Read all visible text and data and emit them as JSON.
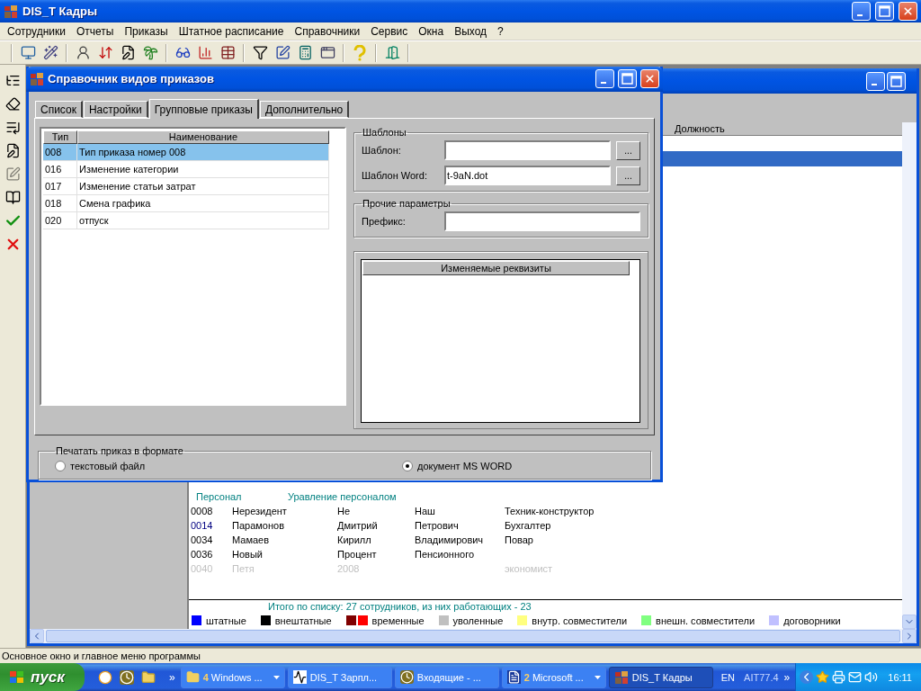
{
  "window": {
    "title": "DIS_T Кадры"
  },
  "menu": [
    "Сотрудники",
    "Отчеты",
    "Приказы",
    "Штатное расписание",
    "Справочники",
    "Сервис",
    "Окна",
    "Выход",
    "?"
  ],
  "employee_list": {
    "columns": [
      "Должность"
    ],
    "top_rows": [
      {
        "selected": true
      }
    ],
    "group": {
      "label": "Персонал",
      "department": "Уравление персоналом"
    },
    "rows": [
      {
        "code": "0008",
        "last": "Нерезидент",
        "first": "Не",
        "middle": "Наш",
        "position": "Техник-конструктор",
        "dismissed": false
      },
      {
        "code": "0014",
        "last": "Парамонов",
        "first": "Дмитрий",
        "middle": "Петрович",
        "position": "Бухгалтер",
        "color": "#000080",
        "dismissed": false
      },
      {
        "code": "0034",
        "last": "Мамаев",
        "first": "Кирилл",
        "middle": "Владимирович",
        "position": "Повар",
        "dismissed": false
      },
      {
        "code": "0036",
        "last": "Новый",
        "first": "Процент",
        "middle": "Пенсионного",
        "dismissed": false
      },
      {
        "code": "0040",
        "last": "Петя",
        "first": "2008",
        "position": "экономист",
        "dismissed": true
      }
    ],
    "summary": "Итого по списку: 27 сотрудников, из них работающих - 23",
    "legend": [
      {
        "label": "штатные",
        "swatches": [
          {
            "color": "#0000ff"
          }
        ]
      },
      {
        "label": "внештатные",
        "swatches": [
          {
            "color": "#000000"
          }
        ]
      },
      {
        "label": "временные",
        "swatches": [
          {
            "color": "#800000"
          },
          {
            "color": "#ff0000"
          }
        ]
      },
      {
        "label": "уволенные",
        "swatches": [
          {
            "color": "#c0c0c0"
          }
        ]
      },
      {
        "label": "внутр. совместители",
        "swatches": [
          {
            "color": "#ffff80"
          }
        ]
      },
      {
        "label": "внешн. совместители",
        "swatches": [
          {
            "color": "#80ff80"
          }
        ]
      },
      {
        "label": "договорники",
        "swatches": [
          {
            "color": "#c0c0ff"
          }
        ]
      }
    ]
  },
  "dialog": {
    "title": "Справочник видов приказов",
    "tabs": [
      {
        "label": "Список",
        "selected": false
      },
      {
        "label": "Настройки",
        "selected": false
      },
      {
        "label": "Групповые приказы",
        "selected": true
      },
      {
        "label": "Дополнительно",
        "selected": false
      }
    ],
    "types_table": {
      "columns": [
        "Тип",
        "Наименование"
      ],
      "rows": [
        {
          "code": "008",
          "name": "Тип приказа номер 008",
          "selected": true
        },
        {
          "code": "016",
          "name": "Изменение категории",
          "selected": false
        },
        {
          "code": "017",
          "name": "Изменение статьи затрат",
          "selected": false
        },
        {
          "code": "018",
          "name": "Смена графика",
          "selected": false
        },
        {
          "code": "020",
          "name": "отпуск",
          "selected": false
        }
      ]
    },
    "templates": {
      "legend": "Шаблоны",
      "fields": [
        {
          "label": "Шаблон:",
          "button": "..."
        },
        {
          "label": "Шаблон Word:",
          "value": "t-9aN.dot",
          "button": "..."
        }
      ]
    },
    "other": {
      "legend": "Прочие параметры",
      "fields": [
        {
          "label": "Префикс:"
        }
      ]
    },
    "attributes": {
      "column": "Изменяемые реквизиты"
    },
    "print_format": {
      "legend": "Печатать приказ в формате",
      "options": [
        {
          "label": "текстовый файл",
          "selected": false
        },
        {
          "label": "документ  MS WORD",
          "selected": true
        }
      ]
    }
  },
  "status_bar": "Основное окно и главное меню программы",
  "taskbar": {
    "start": "пуск",
    "overflow": "»",
    "tasks": [
      {
        "kind": "folder",
        "count": "4",
        "label": "Windows ...",
        "grouped": true,
        "selected": false
      },
      {
        "kind": "chart",
        "label": "DIS_T Зарпл...",
        "grouped": false,
        "selected": false
      },
      {
        "kind": "clock",
        "label": "Входящие - ...",
        "grouped": false,
        "selected": false
      },
      {
        "kind": "word",
        "count": "2",
        "label": "Microsoft ...",
        "grouped": true,
        "selected": false
      },
      {
        "kind": "app",
        "label": "DIS_T Кадры",
        "grouped": false,
        "selected": true
      }
    ],
    "language": "EN",
    "indicator": "AIT77.4",
    "tray_overflow": "»",
    "clock": "16:11"
  }
}
